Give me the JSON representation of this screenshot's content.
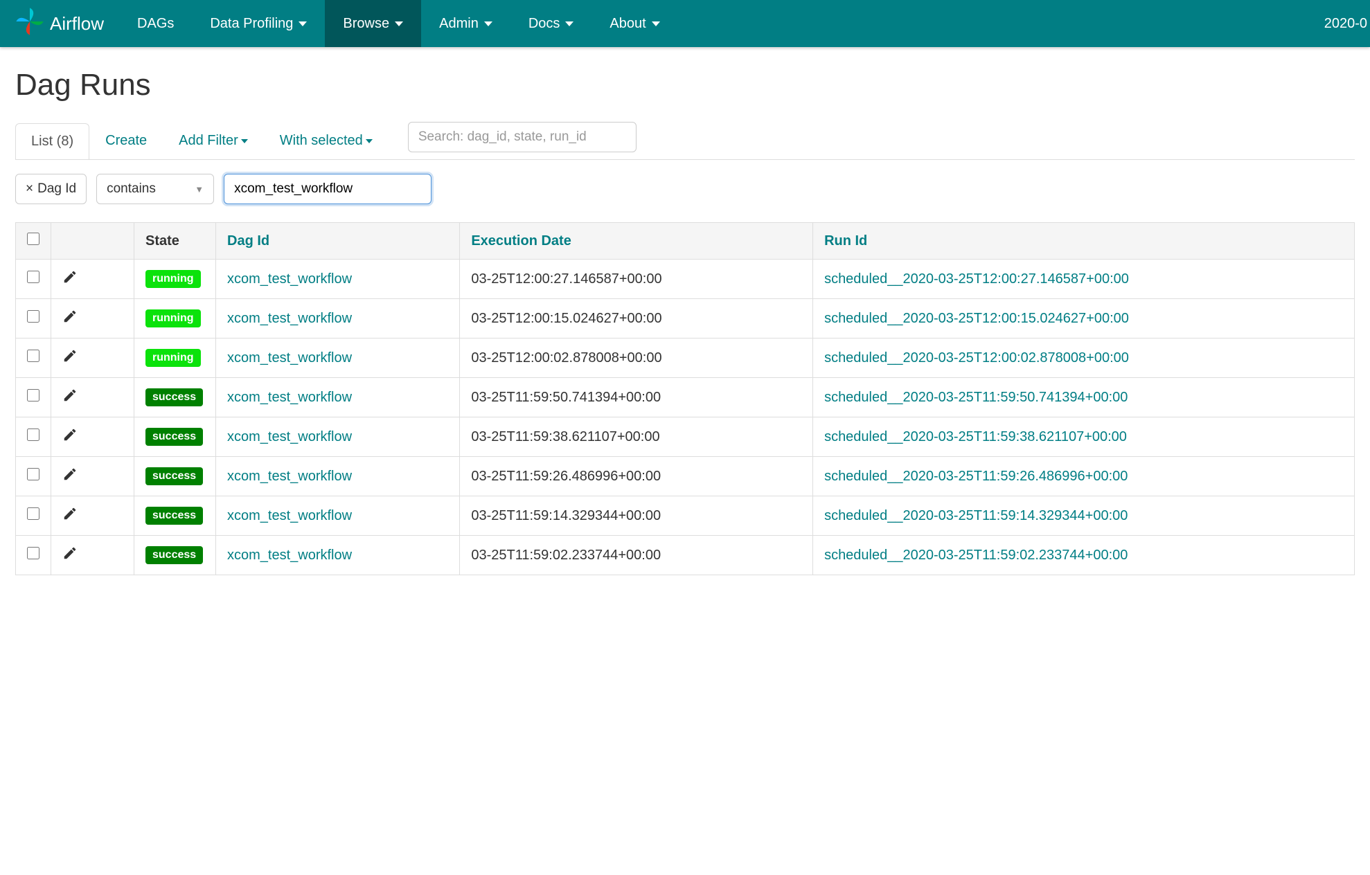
{
  "brand": "Airflow",
  "clock": "2020-0",
  "nav": [
    {
      "label": "DAGs",
      "dropdown": false,
      "active": false
    },
    {
      "label": "Data Profiling",
      "dropdown": true,
      "active": false
    },
    {
      "label": "Browse",
      "dropdown": true,
      "active": true
    },
    {
      "label": "Admin",
      "dropdown": true,
      "active": false
    },
    {
      "label": "Docs",
      "dropdown": true,
      "active": false
    },
    {
      "label": "About",
      "dropdown": true,
      "active": false
    }
  ],
  "page_title": "Dag Runs",
  "tabs": {
    "list_label": "List (8)",
    "create": "Create",
    "add_filter": "Add Filter",
    "with_selected": "With selected"
  },
  "search_placeholder": "Search: dag_id, state, run_id",
  "filter": {
    "field": "Dag Id",
    "op": "contains",
    "value": "xcom_test_workflow"
  },
  "columns": {
    "state": "State",
    "dag_id": "Dag Id",
    "execution_date": "Execution Date",
    "run_id": "Run Id"
  },
  "rows": [
    {
      "state": "running",
      "dag_id": "xcom_test_workflow",
      "execution_date": "03-25T12:00:27.146587+00:00",
      "run_id": "scheduled__2020-03-25T12:00:27.146587+00:00"
    },
    {
      "state": "running",
      "dag_id": "xcom_test_workflow",
      "execution_date": "03-25T12:00:15.024627+00:00",
      "run_id": "scheduled__2020-03-25T12:00:15.024627+00:00"
    },
    {
      "state": "running",
      "dag_id": "xcom_test_workflow",
      "execution_date": "03-25T12:00:02.878008+00:00",
      "run_id": "scheduled__2020-03-25T12:00:02.878008+00:00"
    },
    {
      "state": "success",
      "dag_id": "xcom_test_workflow",
      "execution_date": "03-25T11:59:50.741394+00:00",
      "run_id": "scheduled__2020-03-25T11:59:50.741394+00:00"
    },
    {
      "state": "success",
      "dag_id": "xcom_test_workflow",
      "execution_date": "03-25T11:59:38.621107+00:00",
      "run_id": "scheduled__2020-03-25T11:59:38.621107+00:00"
    },
    {
      "state": "success",
      "dag_id": "xcom_test_workflow",
      "execution_date": "03-25T11:59:26.486996+00:00",
      "run_id": "scheduled__2020-03-25T11:59:26.486996+00:00"
    },
    {
      "state": "success",
      "dag_id": "xcom_test_workflow",
      "execution_date": "03-25T11:59:14.329344+00:00",
      "run_id": "scheduled__2020-03-25T11:59:14.329344+00:00"
    },
    {
      "state": "success",
      "dag_id": "xcom_test_workflow",
      "execution_date": "03-25T11:59:02.233744+00:00",
      "run_id": "scheduled__2020-03-25T11:59:02.233744+00:00"
    }
  ]
}
